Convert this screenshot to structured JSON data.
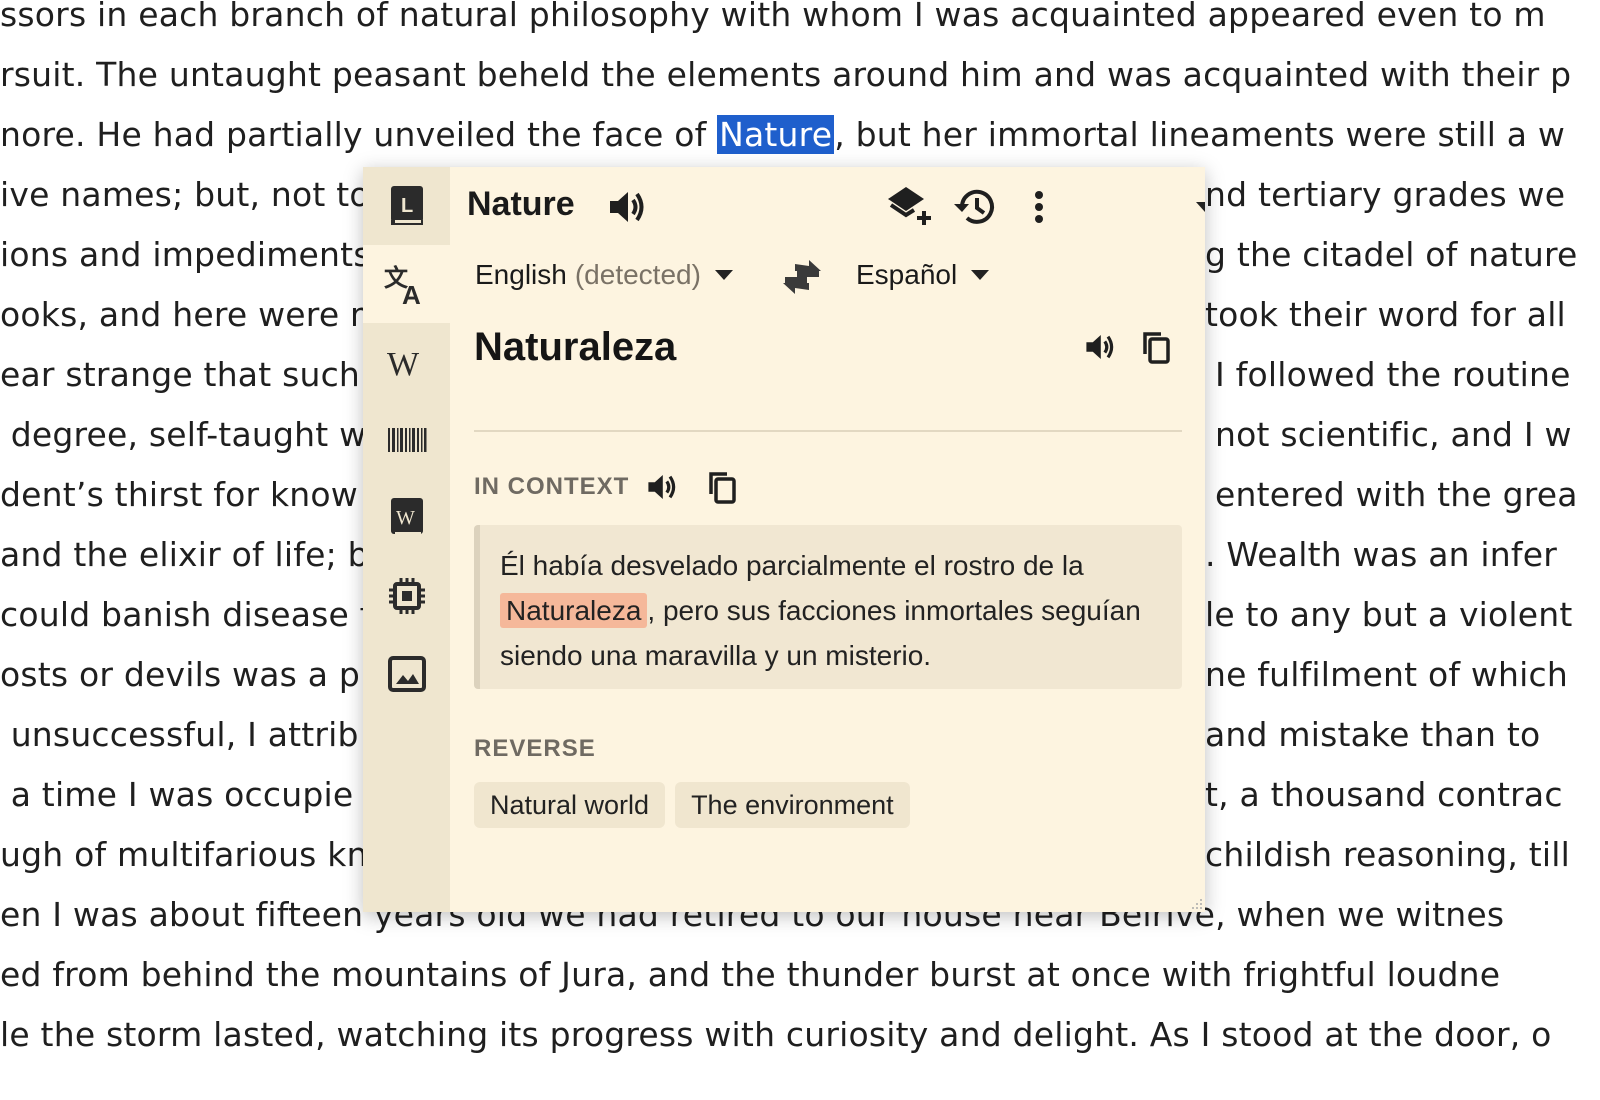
{
  "reader": {
    "lines": [
      {
        "text": "ssors in each branch of natural philosophy with whom I was acquainted appeared even to m"
      },
      {
        "text": "rsuit. The untaught peasant beheld the elements around him and was acquainted with their p"
      },
      {
        "pre": "nore. He had partially unveiled the face of ",
        "hl": "Nature",
        "post": ", but her immortal lineaments were still a w"
      },
      {
        "left": "ive names; but, not to",
        "right": "nd tertiary grades we"
      },
      {
        "left": "ions and impediments",
        "right": "g the citadel of nature"
      },
      {
        "left": "ooks, and here were m",
        "right": "took their word for all"
      },
      {
        "left": "ear strange that such",
        "right": "I followed the routine"
      },
      {
        "left": " degree, self-taught w",
        "right": "not scientific, and I w"
      },
      {
        "left": "dent’s thirst for know",
        "right": "entered with the grea"
      },
      {
        "left": "and the elixir of life; bu",
        "right": ". Wealth was an infer"
      },
      {
        "left": "could banish disease f",
        "right": "le to any but a violent"
      },
      {
        "left": "osts or devils was a pro",
        "right": "ne fulfilment of which"
      },
      {
        "left": " unsuccessful, I attrib",
        "right": "and mistake than to"
      },
      {
        "left": " a time I was occupie",
        "right": "t, a thousand contrac"
      },
      {
        "left": "ugh of multifarious kn",
        "right": "childish reasoning, till"
      },
      {
        "text": "en I was about fifteen years old we had retired to our house near Belrive, when we witnes"
      },
      {
        "text": "ed from behind the mountains of Jura, and the thunder burst at once with frightful loudne"
      },
      {
        "text": "le the storm lasted, watching its progress with curiosity and delight. As I stood at the door, o"
      }
    ]
  },
  "popup": {
    "rail": [
      {
        "icon": "dictionary-icon",
        "active": false
      },
      {
        "icon": "translate-icon",
        "active": true
      },
      {
        "icon": "wikipedia-icon",
        "active": false
      },
      {
        "icon": "barcode-icon",
        "active": false
      },
      {
        "icon": "wiktionary-icon",
        "active": false
      },
      {
        "icon": "chip-icon",
        "active": false
      },
      {
        "icon": "image-icon",
        "active": false
      }
    ],
    "word": "Nature",
    "target_lang_code": "ES",
    "source_lang": "English",
    "source_detected": "(detected)",
    "target_lang": "Español",
    "translation": "Naturaleza",
    "in_context_label": "IN CONTEXT",
    "context": {
      "before": "Él había desvelado parcialmente el rostro de la",
      "highlight": "Naturaleza",
      "after": ", pero sus facciones inmortales seguían siendo una maravilla y un misterio."
    },
    "reverse_label": "REVERSE",
    "reverse": [
      "Natural world",
      "The environment"
    ],
    "colors": {
      "popup_bg": "#fdf4e0",
      "rail_bg": "#efe6cf",
      "selection": "#1f5fcc",
      "context_highlight": "#f5b89a"
    }
  }
}
